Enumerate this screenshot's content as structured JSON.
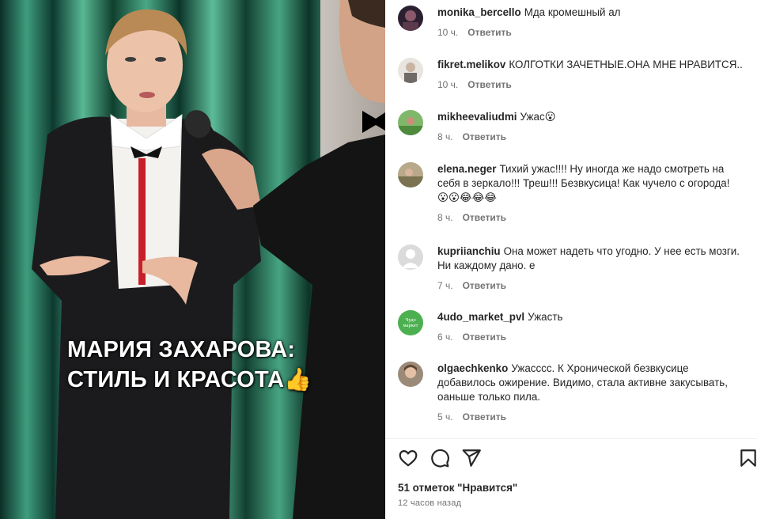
{
  "post": {
    "caption_line1": "МАРИЯ ЗАХАРОВА:",
    "caption_line2": "СТИЛЬ И КРАСОТА",
    "caption_emoji": "👍"
  },
  "comments": [
    {
      "username": "monika_bercello",
      "text": "Мда кромешный ал",
      "time": "10 ч.",
      "reply": "Ответить",
      "avatar": "avatar-dark-photo"
    },
    {
      "username": "fikret.melikov",
      "text": "КОЛГОТКИ ЗАЧЕТНЫЕ.ОНА МНЕ НРАВИТСЯ..",
      "time": "10 ч.",
      "reply": "Ответить",
      "avatar": "avatar-light-photo"
    },
    {
      "username": "mikheevaliudmi",
      "text": "Ужас",
      "emoji": "😮",
      "time": "8 ч.",
      "reply": "Ответить",
      "avatar": "avatar-nature-photo"
    },
    {
      "username": "elena.neger",
      "text": "Тихий ужас!!!! Ну иногда же надо смотреть на себя в зеркало!!! Треш!!! Безвкусица! Как чучело с огорода!",
      "emoji": "😮😮😂😂😂",
      "time": "8 ч.",
      "reply": "Ответить",
      "avatar": "avatar-outdoor-photo"
    },
    {
      "username": "kupriianchiu",
      "text": "Она может надеть что угодно. У нее есть мозги. Ни каждому дано. е",
      "time": "7 ч.",
      "reply": "Ответить",
      "avatar": "avatar-default-icon"
    },
    {
      "username": "4udo_market_pvl",
      "text": "Ужасть",
      "time": "6 ч.",
      "reply": "Ответить",
      "avatar": "avatar-logo",
      "avatar_text": "Чудо маркет"
    },
    {
      "username": "olgaechkenko",
      "text": "Ужасссс. К Хронической безвкусице добавилось ожирение. Видимо, стала активне закусывать, оаньше только пила.",
      "time": "5 ч.",
      "reply": "Ответить",
      "avatar": "avatar-portrait-photo"
    }
  ],
  "actions": {
    "like_icon": "heart-icon",
    "comment_icon": "comment-icon",
    "share_icon": "paper-plane-icon",
    "save_icon": "bookmark-icon"
  },
  "likes_text": "51 отметок \"Нравится\"",
  "posted_time": "12 часов назад",
  "colors": {
    "curtain_dark": "#0e3a30",
    "curtain_light": "#4fb08f",
    "text_primary": "#262626",
    "text_secondary": "#737373",
    "logo_green": "#4caf50"
  }
}
